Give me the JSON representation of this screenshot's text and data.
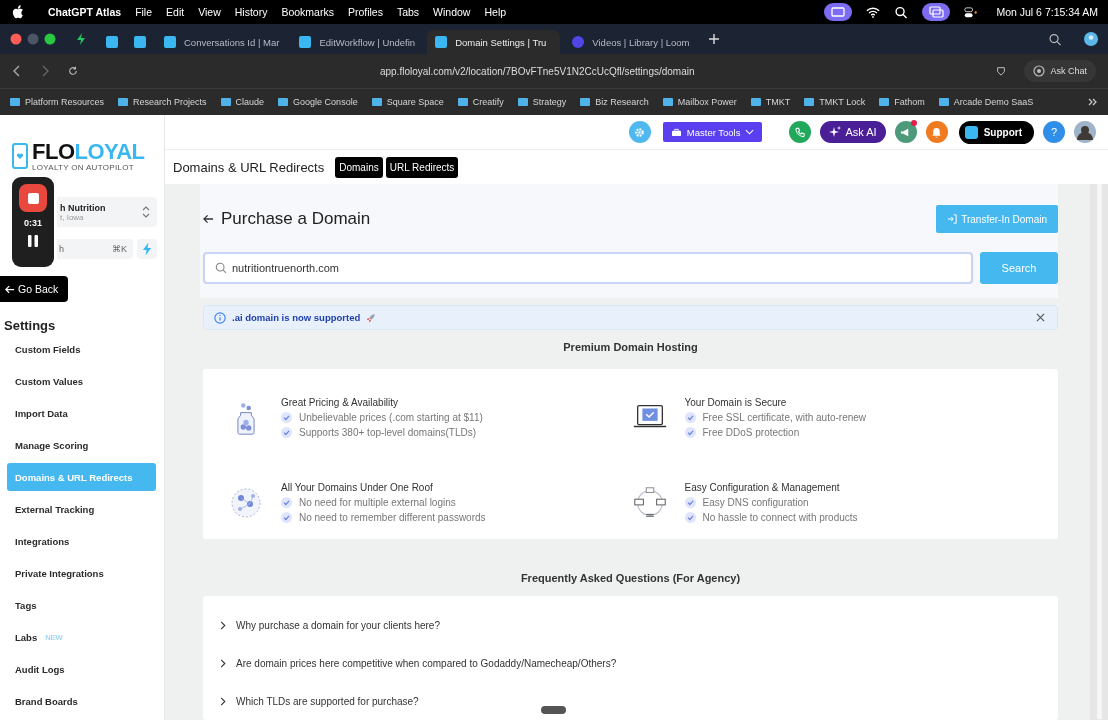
{
  "menubar": {
    "app": "ChatGPT Atlas",
    "menus": [
      "File",
      "Edit",
      "View",
      "History",
      "Bookmarks",
      "Profiles",
      "Tabs",
      "Window",
      "Help"
    ],
    "clock": "Mon Jul 6  7:15:34 AM"
  },
  "browser_tabs": [
    {
      "kind": "pinned",
      "selected": false
    },
    {
      "kind": "pinned",
      "selected": false
    },
    {
      "kind": "page",
      "title": "Conversations Id | Mar",
      "selected": false
    },
    {
      "kind": "page",
      "title": "EditWorkflow | Undefin",
      "selected": false
    },
    {
      "kind": "page",
      "title": "Domain Settings | Tru",
      "selected": true
    },
    {
      "kind": "page",
      "title": "Videos | Library | Loom",
      "selected": false
    }
  ],
  "address_bar": {
    "url": "app.floloyal.com/v2/location/7BOvFTne5V1N2CcUcQfl/settings/domain",
    "ask_chat": "Ask Chat"
  },
  "bookmarks": [
    "Platform Resources",
    "Research Projects",
    "Claude",
    "Google Console",
    "Square Space",
    "Creatify",
    "Strategy",
    "Biz Research",
    "Mailbox Power",
    "TMKT",
    "TMKT Lock",
    "Fathom",
    "Arcade Demo SaaS"
  ],
  "header": {
    "master_tools": "Master Tools",
    "ask_ai": "Ask AI",
    "support": "Support",
    "help": "?"
  },
  "logo": {
    "first": "FLO",
    "second": "LOYAL",
    "tagline": "LOYALTY ON AUTOPILOT"
  },
  "recorder": {
    "time": "0:31"
  },
  "account": {
    "name": "h Nutrition",
    "location": "t, Iowa"
  },
  "sidebar_search": {
    "placeholder": "h",
    "shortcut": "⌘K"
  },
  "go_back": "Go Back",
  "settings": {
    "title": "Settings",
    "items": [
      {
        "label": "Custom Fields",
        "selected": false
      },
      {
        "label": "Custom Values",
        "selected": false
      },
      {
        "label": "Import Data",
        "selected": false
      },
      {
        "label": "Manage Scoring",
        "selected": false
      },
      {
        "label": "Domains & URL Redirects",
        "selected": true
      },
      {
        "label": "External Tracking",
        "selected": false
      },
      {
        "label": "Integrations",
        "selected": false
      },
      {
        "label": "Private Integrations",
        "selected": false
      },
      {
        "label": "Tags",
        "selected": false
      },
      {
        "label": "Labs",
        "badge": "NEW",
        "selected": false
      },
      {
        "label": "Audit Logs",
        "selected": false
      },
      {
        "label": "Brand Boards",
        "selected": false
      }
    ]
  },
  "page": {
    "title": "Domains & URL Redirects",
    "tabs": [
      "Domains",
      "URL Redirects"
    ]
  },
  "purchase": {
    "title": "Purchase a Domain",
    "transfer_button": "Transfer-In Domain",
    "search_value": "nutritiontruenorth.com",
    "search_button": "Search"
  },
  "banner": {
    "text": ".ai domain is now supported"
  },
  "features": {
    "heading": "Premium Domain Hosting",
    "items": [
      {
        "kind": "pricing",
        "title": "Great Pricing & Availability",
        "points": [
          "Unbelievable prices (.com starting at $11)",
          "Supports 380+ top-level domains(TLDs)"
        ]
      },
      {
        "kind": "security",
        "title": "Your Domain is Secure",
        "points": [
          "Free SSL certificate, with auto-renew",
          "Free DDoS protection"
        ]
      },
      {
        "kind": "globe",
        "title": "All Your Domains Under One Roof",
        "points": [
          "No need for multiple external logins",
          "No need to remember different passwords"
        ]
      },
      {
        "kind": "config",
        "title": "Easy Configuration & Management",
        "points": [
          "Easy DNS configuration",
          "No hassle to connect with products"
        ]
      }
    ]
  },
  "faq": {
    "heading": "Frequently Asked Questions (For Agency)",
    "questions": [
      "Why purchase a domain for your clients here?",
      "Are domain prices here competitive when compared to Godaddy/Namecheap/Others?",
      "Which TLDs are supported for purchase?"
    ]
  }
}
